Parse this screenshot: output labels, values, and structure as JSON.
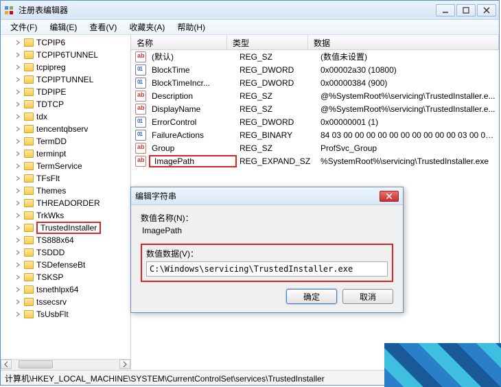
{
  "window": {
    "title": "注册表编辑器"
  },
  "menu": {
    "file": "文件(F)",
    "edit": "编辑(E)",
    "view": "查看(V)",
    "favorites": "收藏夹(A)",
    "help": "帮助(H)"
  },
  "tree": {
    "items": [
      "TCPIP6",
      "TCPIP6TUNNEL",
      "tcpipreg",
      "TCPIPTUNNEL",
      "TDPIPE",
      "TDTCP",
      "tdx",
      "tencentqbserv",
      "TermDD",
      "terminpt",
      "TermService",
      "TFsFlt",
      "Themes",
      "THREADORDER",
      "TrkWks",
      "TrustedInstaller",
      "TS888x64",
      "TSDDD",
      "TSDefenseBt",
      "TSKSP",
      "tsnethlpx64",
      "tssecsrv",
      "TsUsbFlt"
    ],
    "selected_index": 15
  },
  "columns": {
    "name": "名称",
    "type": "类型",
    "data": "数据"
  },
  "values": [
    {
      "icon": "str",
      "name": "(默认)",
      "type": "REG_SZ",
      "data": "(数值未设置)"
    },
    {
      "icon": "bin",
      "name": "BlockTime",
      "type": "REG_DWORD",
      "data": "0x00002a30 (10800)"
    },
    {
      "icon": "bin",
      "name": "BlockTimeIncr...",
      "type": "REG_DWORD",
      "data": "0x00000384 (900)"
    },
    {
      "icon": "str",
      "name": "Description",
      "type": "REG_SZ",
      "data": "@%SystemRoot%\\servicing\\TrustedInstaller.e..."
    },
    {
      "icon": "str",
      "name": "DisplayName",
      "type": "REG_SZ",
      "data": "@%SystemRoot%\\servicing\\TrustedInstaller.e..."
    },
    {
      "icon": "bin",
      "name": "ErrorControl",
      "type": "REG_DWORD",
      "data": "0x00000001 (1)"
    },
    {
      "icon": "bin",
      "name": "FailureActions",
      "type": "REG_BINARY",
      "data": "84 03 00 00 00 00 00 00 00 00 00 00 03 00 00 0..."
    },
    {
      "icon": "str",
      "name": "Group",
      "type": "REG_SZ",
      "data": "ProfSvc_Group"
    },
    {
      "icon": "str",
      "name": "ImagePath",
      "type": "REG_EXPAND_SZ",
      "data": "%SystemRoot%\\servicing\\TrustedInstaller.exe",
      "highlighted": true
    }
  ],
  "dialog": {
    "title": "编辑字符串",
    "name_label": "数值名称(N)：",
    "name_value": "ImagePath",
    "data_label": "数值数据(V)：",
    "data_value": "C:\\Windows\\servicing\\TrustedInstaller.exe",
    "ok": "确定",
    "cancel": "取消"
  },
  "statusbar": "计算机\\HKEY_LOCAL_MACHINE\\SYSTEM\\CurrentControlSet\\services\\TrustedInstaller"
}
